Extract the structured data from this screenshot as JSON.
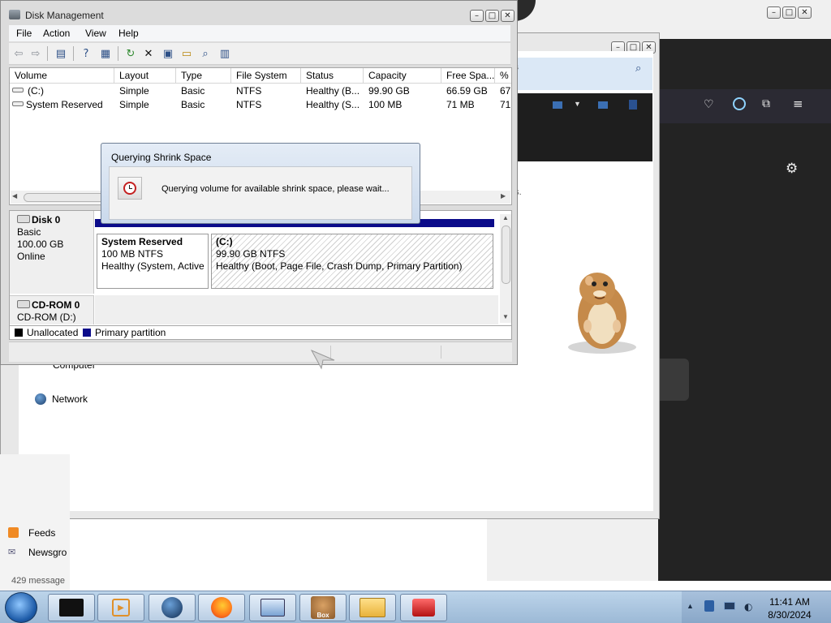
{
  "disk_management": {
    "title": "Disk Management",
    "menu": [
      "File",
      "Action",
      "View",
      "Help"
    ],
    "volume_table": {
      "columns": [
        "Volume",
        "Layout",
        "Type",
        "File System",
        "Status",
        "Capacity",
        "Free Spa...",
        "%"
      ],
      "rows": [
        [
          "(C:)",
          "Simple",
          "Basic",
          "NTFS",
          "Healthy (B...",
          "99.90 GB",
          "66.59 GB",
          "67"
        ],
        [
          "System Reserved",
          "Simple",
          "Basic",
          "NTFS",
          "Healthy (S...",
          "100 MB",
          "71 MB",
          "71"
        ]
      ]
    },
    "disks": [
      {
        "name": "Disk 0",
        "type": "Basic",
        "size": "100.00 GB",
        "state": "Online"
      },
      {
        "name": "CD-ROM 0",
        "type": "CD-ROM (D:)"
      }
    ],
    "partitions": [
      {
        "name": "System Reserved",
        "size": "100 MB NTFS",
        "status": "Healthy (System, Active"
      },
      {
        "name": "(C:)",
        "size": "99.90 GB NTFS",
        "status": "Healthy (Boot, Page File, Crash Dump, Primary Partition)"
      }
    ],
    "legend": [
      "Unallocated",
      "Primary partition"
    ],
    "legend_colors": {
      "unallocated": "#000000",
      "primary": "#0b0b8a"
    }
  },
  "dialog": {
    "title": "Querying Shrink Space",
    "message": "Querying volume for available shrink space, please wait..."
  },
  "explorer": {
    "nav": [
      "Computer",
      "Network"
    ],
    "partial_text": {
      "ies": "ies",
      "es_dot": "es."
    }
  },
  "mail_strip": {
    "feeds": "Feeds",
    "newsgroups": "Newsgro",
    "status": "429 message"
  },
  "taskbar": {
    "time": "11:41 AM",
    "date": "8/30/2024",
    "box_label": "Box"
  }
}
